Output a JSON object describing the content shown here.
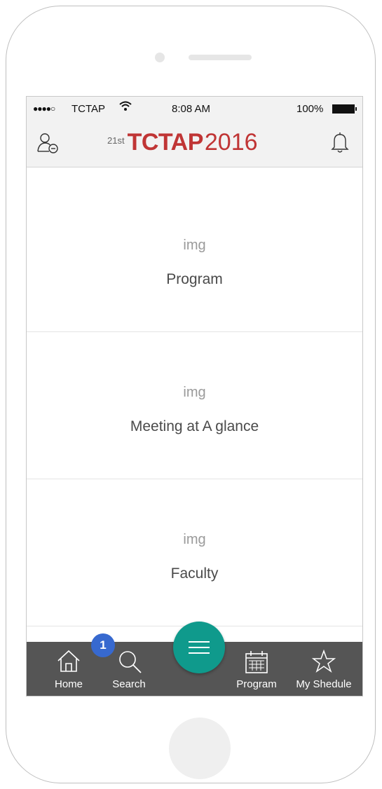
{
  "status_bar": {
    "signal": "●●●●○",
    "carrier": "TCTAP",
    "wifi_icon": "wifi-icon",
    "time": "8:08 AM",
    "battery_percent": "100%"
  },
  "header": {
    "logo_sup": "21st",
    "logo_brand": "TCTAP",
    "logo_year": "2016",
    "left_icon": "user-icon",
    "right_icon": "bell-icon",
    "accent_color": "#c03535"
  },
  "menu": {
    "items": [
      {
        "img": "img",
        "label": "Program"
      },
      {
        "img": "img",
        "label": "Meeting at A glance"
      },
      {
        "img": "img",
        "label": "Faculty"
      }
    ]
  },
  "tab_bar": {
    "background": "#555555",
    "tabs": [
      {
        "label": "Home",
        "icon": "home-icon"
      },
      {
        "label": "Search",
        "icon": "search-icon"
      },
      {
        "label": "Program",
        "icon": "calendar-icon"
      },
      {
        "label": "My Shedule",
        "icon": "star-icon"
      }
    ],
    "badge_count": "1",
    "fab_icon": "menu-icon",
    "fab_color": "#0f9a8c"
  }
}
